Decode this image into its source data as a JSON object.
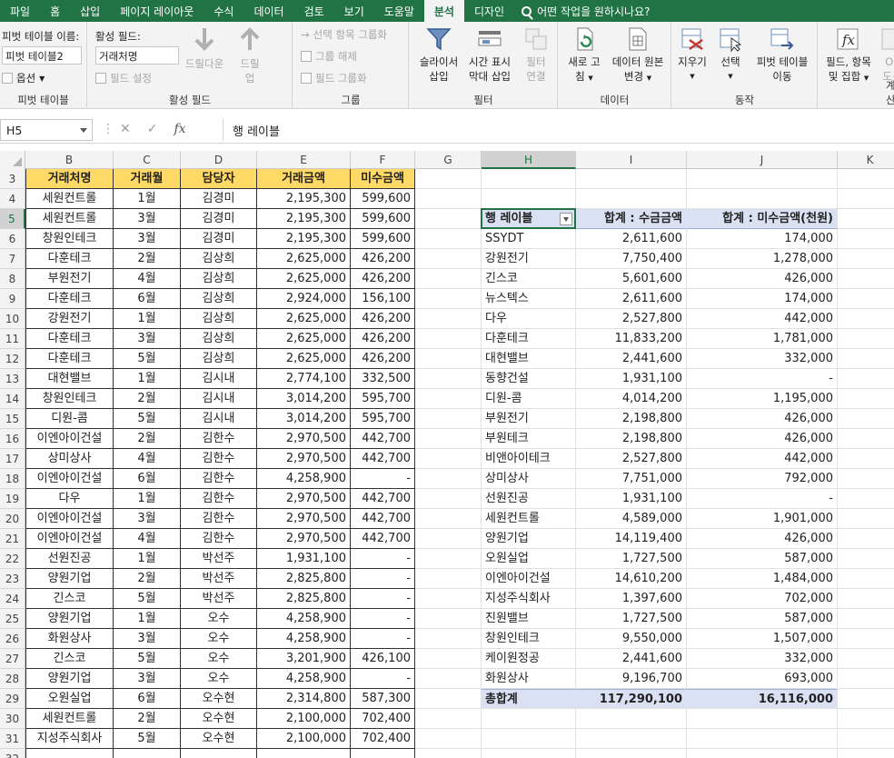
{
  "tabs": [
    "파일",
    "홈",
    "삽입",
    "페이지 레이아웃",
    "수식",
    "데이터",
    "검토",
    "보기",
    "도움말",
    "분석",
    "디자인"
  ],
  "active_tab": "분석",
  "tell_me": "어떤 작업을 원하시나요?",
  "ribbon": {
    "pivot_name_label": "피벗 테이블 이름:",
    "pivot_name_value": "피벗 테이블2",
    "options_label": "옵션",
    "pivot_group": "피벗 테이블",
    "active_field_label": "활성 필드:",
    "active_field_value": "거래처명",
    "field_settings": "필드 설정",
    "drill_down": "드릴다운",
    "drill_up": "드릴",
    "drill_up2": "업",
    "active_group": "활성 필드",
    "group_selection": "선택 항목 그룹화",
    "ungroup": "그룹 해제",
    "group_field": "필드 그룹화",
    "group_group": "그룹",
    "slicer": [
      "슬라이서",
      "삽입"
    ],
    "timeline": [
      "시간 표시",
      "막대 삽입"
    ],
    "filter_conn": [
      "필터",
      "연결"
    ],
    "filter_group": "필터",
    "refresh": [
      "새로 고",
      "침"
    ],
    "change_source": [
      "데이터 원본",
      "변경"
    ],
    "data_group": "데이터",
    "clear": "지우기",
    "select": "선택",
    "move_pivot": [
      "피벗 테이블",
      "이동"
    ],
    "action_group": "동작",
    "fields_items": [
      "필드, 항목",
      "및 집합"
    ],
    "olap": [
      "OL",
      "도구"
    ],
    "calc_group": "계산"
  },
  "formula": {
    "name_box": "H5",
    "content": "행 레이블"
  },
  "columns": [
    "A",
    "B",
    "C",
    "D",
    "E",
    "F",
    "G",
    "H",
    "I",
    "J",
    "K"
  ],
  "source_headers": [
    "거래처명",
    "거래월",
    "담당자",
    "거래금액",
    "미수금액"
  ],
  "source_rows": [
    {
      "r": "4",
      "cells": [
        "세원컨트롤",
        "1월",
        "김경미",
        "2,195,300",
        "599,600"
      ]
    },
    {
      "r": "5",
      "cells": [
        "세원컨트롤",
        "3월",
        "김경미",
        "2,195,300",
        "599,600"
      ]
    },
    {
      "r": "6",
      "cells": [
        "창원인테크",
        "3월",
        "김경미",
        "2,195,300",
        "599,600"
      ]
    },
    {
      "r": "7",
      "cells": [
        "다훈테크",
        "2월",
        "김상희",
        "2,625,000",
        "426,200"
      ]
    },
    {
      "r": "8",
      "cells": [
        "부원전기",
        "4월",
        "김상희",
        "2,625,000",
        "426,200"
      ]
    },
    {
      "r": "9",
      "cells": [
        "다훈테크",
        "6월",
        "김상희",
        "2,924,000",
        "156,100"
      ]
    },
    {
      "r": "10",
      "cells": [
        "강원전기",
        "1월",
        "김상희",
        "2,625,000",
        "426,200"
      ]
    },
    {
      "r": "11",
      "cells": [
        "다훈테크",
        "3월",
        "김상희",
        "2,625,000",
        "426,200"
      ]
    },
    {
      "r": "12",
      "cells": [
        "다훈테크",
        "5월",
        "김상희",
        "2,625,000",
        "426,200"
      ]
    },
    {
      "r": "13",
      "cells": [
        "대현밸브",
        "1월",
        "김시내",
        "2,774,100",
        "332,500"
      ]
    },
    {
      "r": "14",
      "cells": [
        "창원인테크",
        "2월",
        "김시내",
        "3,014,200",
        "595,700"
      ]
    },
    {
      "r": "15",
      "cells": [
        "디원-콤",
        "5월",
        "김시내",
        "3,014,200",
        "595,700"
      ]
    },
    {
      "r": "16",
      "cells": [
        "이엔아이건설",
        "2월",
        "김한수",
        "2,970,500",
        "442,700"
      ]
    },
    {
      "r": "17",
      "cells": [
        "상미상사",
        "4월",
        "김한수",
        "2,970,500",
        "442,700"
      ]
    },
    {
      "r": "18",
      "cells": [
        "이엔아이건설",
        "6월",
        "김한수",
        "4,258,900",
        "-"
      ]
    },
    {
      "r": "19",
      "cells": [
        "다우",
        "1월",
        "김한수",
        "2,970,500",
        "442,700"
      ]
    },
    {
      "r": "20",
      "cells": [
        "이엔아이건설",
        "3월",
        "김한수",
        "2,970,500",
        "442,700"
      ]
    },
    {
      "r": "21",
      "cells": [
        "이엔아이건설",
        "4월",
        "김한수",
        "2,970,500",
        "442,700"
      ]
    },
    {
      "r": "22",
      "cells": [
        "선원진공",
        "1월",
        "박선주",
        "1,931,100",
        "-"
      ]
    },
    {
      "r": "23",
      "cells": [
        "양원기업",
        "2월",
        "박선주",
        "2,825,800",
        "-"
      ]
    },
    {
      "r": "24",
      "cells": [
        "긴스코",
        "5월",
        "박선주",
        "2,825,800",
        "-"
      ]
    },
    {
      "r": "25",
      "cells": [
        "양원기업",
        "1월",
        "오수",
        "4,258,900",
        "-"
      ]
    },
    {
      "r": "26",
      "cells": [
        "화원상사",
        "3월",
        "오수",
        "4,258,900",
        "-"
      ]
    },
    {
      "r": "27",
      "cells": [
        "긴스코",
        "5월",
        "오수",
        "3,201,900",
        "426,100"
      ]
    },
    {
      "r": "28",
      "cells": [
        "양원기업",
        "3월",
        "오수",
        "4,258,900",
        "-"
      ]
    },
    {
      "r": "29",
      "cells": [
        "오원실업",
        "6월",
        "오수현",
        "2,314,800",
        "587,300"
      ]
    },
    {
      "r": "30",
      "cells": [
        "세원컨트롤",
        "2월",
        "오수현",
        "2,100,000",
        "702,400"
      ]
    },
    {
      "r": "31",
      "cells": [
        "지성주식회사",
        "5월",
        "오수현",
        "2,100,000",
        "702,400"
      ]
    }
  ],
  "pivot": {
    "header": [
      "행 레이블",
      "합계 : 수금금액",
      "합계 : 미수금액(천원)"
    ],
    "rows": [
      [
        "SSYDT",
        "2,611,600",
        "174,000"
      ],
      [
        "강원전기",
        "7,750,400",
        "1,278,000"
      ],
      [
        "긴스코",
        "5,601,600",
        "426,000"
      ],
      [
        "뉴스텍스",
        "2,611,600",
        "174,000"
      ],
      [
        "다우",
        "2,527,800",
        "442,000"
      ],
      [
        "다훈테크",
        "11,833,200",
        "1,781,000"
      ],
      [
        "대현밸브",
        "2,441,600",
        "332,000"
      ],
      [
        "동향건설",
        "1,931,100",
        "-"
      ],
      [
        "디원-콤",
        "4,014,200",
        "1,195,000"
      ],
      [
        "부원전기",
        "2,198,800",
        "426,000"
      ],
      [
        "부원테크",
        "2,198,800",
        "426,000"
      ],
      [
        "비앤아이테크",
        "2,527,800",
        "442,000"
      ],
      [
        "상미상사",
        "7,751,000",
        "792,000"
      ],
      [
        "선원진공",
        "1,931,100",
        "-"
      ],
      [
        "세원컨트롤",
        "4,589,000",
        "1,901,000"
      ],
      [
        "양원기업",
        "14,119,400",
        "426,000"
      ],
      [
        "오원실업",
        "1,727,500",
        "587,000"
      ],
      [
        "이엔아이건설",
        "14,610,200",
        "1,484,000"
      ],
      [
        "지성주식회사",
        "1,397,600",
        "702,000"
      ],
      [
        "진원밸브",
        "1,727,500",
        "587,000"
      ],
      [
        "창원인테크",
        "9,550,000",
        "1,507,000"
      ],
      [
        "케이원정공",
        "2,441,600",
        "332,000"
      ],
      [
        "화원상사",
        "9,196,700",
        "693,000"
      ]
    ],
    "total": [
      "총합계",
      "117,290,100",
      "16,116,000"
    ]
  },
  "last_row_label": "32"
}
